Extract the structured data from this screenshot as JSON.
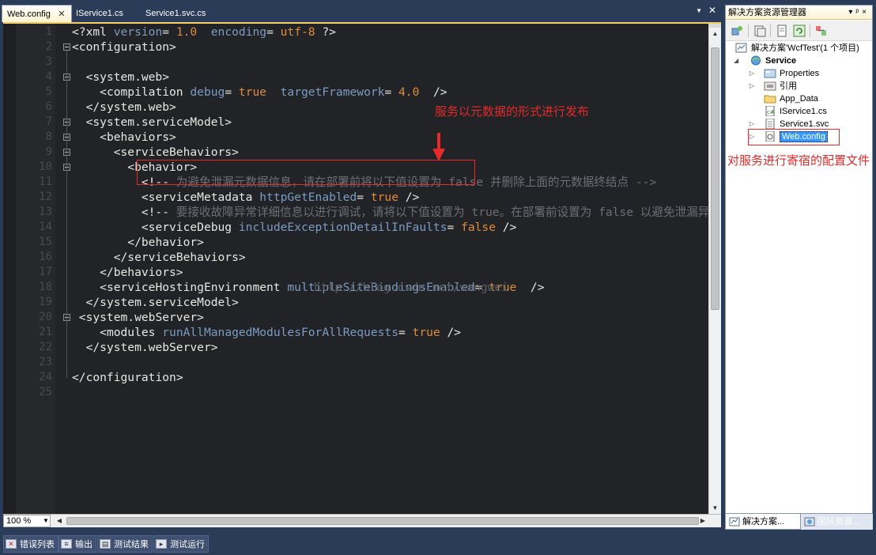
{
  "tabs": [
    {
      "label": "Web.config",
      "active": true
    },
    {
      "label": "IService1.cs",
      "active": false
    },
    {
      "label": "Service1.svc.cs",
      "active": false
    }
  ],
  "editor": {
    "line_numbers": [
      "1",
      "2",
      "3",
      "4",
      "5",
      "6",
      "7",
      "8",
      "9",
      "10",
      "11",
      "12",
      "13",
      "14",
      "15",
      "16",
      "17",
      "18",
      "19",
      "20",
      "21",
      "22",
      "23",
      "24",
      "25"
    ],
    "lines": [
      [
        [
          "punc",
          "<?"
        ],
        [
          "tag",
          "xml"
        ],
        [
          "punc",
          " "
        ],
        [
          "attr",
          "version"
        ],
        [
          "punc",
          "= "
        ],
        [
          "val",
          "1.0"
        ],
        [
          "punc",
          "  "
        ],
        [
          "attr",
          "encoding"
        ],
        [
          "punc",
          "= "
        ],
        [
          "val",
          "utf-8"
        ],
        [
          "punc",
          " ?>"
        ]
      ],
      [
        [
          "punc",
          "<"
        ],
        [
          "tag",
          "configuration"
        ],
        [
          "punc",
          ">"
        ]
      ],
      [],
      [
        [
          "punc",
          "  <"
        ],
        [
          "tag",
          "system.web"
        ],
        [
          "punc",
          ">"
        ]
      ],
      [
        [
          "punc",
          "    <"
        ],
        [
          "tag",
          "compilation"
        ],
        [
          "punc",
          " "
        ],
        [
          "attr",
          "debug"
        ],
        [
          "punc",
          "= "
        ],
        [
          "val",
          "true"
        ],
        [
          "punc",
          "  "
        ],
        [
          "attr",
          "targetFramework"
        ],
        [
          "punc",
          "= "
        ],
        [
          "val",
          "4.0"
        ],
        [
          "punc",
          "  />"
        ]
      ],
      [
        [
          "punc",
          "  </"
        ],
        [
          "tag",
          "system.web"
        ],
        [
          "punc",
          ">"
        ]
      ],
      [
        [
          "punc",
          "  <"
        ],
        [
          "tag",
          "system.serviceModel"
        ],
        [
          "punc",
          ">"
        ]
      ],
      [
        [
          "punc",
          "    <"
        ],
        [
          "tag",
          "behaviors"
        ],
        [
          "punc",
          ">"
        ]
      ],
      [
        [
          "punc",
          "      <"
        ],
        [
          "tag",
          "serviceBehaviors"
        ],
        [
          "punc",
          ">"
        ]
      ],
      [
        [
          "punc",
          "        <"
        ],
        [
          "tag",
          "behavior"
        ],
        [
          "punc",
          ">"
        ]
      ],
      [
        [
          "punc",
          "          <!--"
        ],
        [
          "comment",
          " 为避免泄漏元数据信息，请在部署前将以下值设置为 false 并删除上面的元数据终结点 -->"
        ]
      ],
      [
        [
          "punc",
          "          <"
        ],
        [
          "tag",
          "serviceMetadata"
        ],
        [
          "punc",
          " "
        ],
        [
          "attr",
          "httpGetEnabled"
        ],
        [
          "punc",
          "= "
        ],
        [
          "val",
          "true"
        ],
        [
          "punc",
          " />"
        ]
      ],
      [
        [
          "punc",
          "          <!--"
        ],
        [
          "comment",
          " 要接收故障异常详细信息以进行调试，请将以下值设置为 true。在部署前设置为 false 以避免泄漏异常信息 -->"
        ]
      ],
      [
        [
          "punc",
          "          <"
        ],
        [
          "tag",
          "serviceDebug"
        ],
        [
          "punc",
          " "
        ],
        [
          "attr",
          "includeExceptionDetailInFaults"
        ],
        [
          "punc",
          "= "
        ],
        [
          "val",
          "false"
        ],
        [
          "punc",
          " />"
        ]
      ],
      [
        [
          "punc",
          "        </"
        ],
        [
          "tag",
          "behavior"
        ],
        [
          "punc",
          ">"
        ]
      ],
      [
        [
          "punc",
          "      </"
        ],
        [
          "tag",
          "serviceBehaviors"
        ],
        [
          "punc",
          ">"
        ]
      ],
      [
        [
          "punc",
          "    </"
        ],
        [
          "tag",
          "behaviors"
        ],
        [
          "punc",
          ">"
        ]
      ],
      [
        [
          "punc",
          "    <"
        ],
        [
          "tag",
          "serviceHostingEnvironment"
        ],
        [
          "punc",
          " "
        ],
        [
          "attr",
          "multipleSiteBindingsEnabled"
        ],
        [
          "punc",
          "= "
        ],
        [
          "val",
          "true"
        ],
        [
          "punc",
          "  />"
        ]
      ],
      [
        [
          "punc",
          "  </"
        ],
        [
          "tag",
          "system.serviceModel"
        ],
        [
          "punc",
          ">"
        ]
      ],
      [
        [
          "punc",
          " <"
        ],
        [
          "tag",
          "system.webServer"
        ],
        [
          "punc",
          ">"
        ]
      ],
      [
        [
          "punc",
          "    <"
        ],
        [
          "tag",
          "modules"
        ],
        [
          "punc",
          " "
        ],
        [
          "attr",
          "runAllManagedModulesForAllRequests"
        ],
        [
          "punc",
          "= "
        ],
        [
          "val",
          "true"
        ],
        [
          "punc",
          " />"
        ]
      ],
      [
        [
          "punc",
          "  </"
        ],
        [
          "tag",
          "system.webServer"
        ],
        [
          "punc",
          ">"
        ]
      ],
      [],
      [
        [
          "punc",
          "</"
        ],
        [
          "tag",
          "configuration"
        ],
        [
          "punc",
          ">"
        ]
      ],
      []
    ],
    "watermark": "http://blog.csdn.net/wangwei",
    "annotation_metadata": "服务以元数据的形式进行发布",
    "zoom": "100 %"
  },
  "solution_explorer": {
    "title": "解决方案资源管理器",
    "title_buttons": "▾ ᵖ ×",
    "solution_label": "解决方案'WcfTest'(1 个项目)",
    "project_label": "Service",
    "items": [
      {
        "label": "Properties",
        "icon": "properties-icon",
        "expandable": true
      },
      {
        "label": "引用",
        "icon": "references-icon",
        "expandable": true
      },
      {
        "label": "App_Data",
        "icon": "folder-icon",
        "expandable": false
      },
      {
        "label": "IService1.cs",
        "icon": "csharp-file-icon",
        "expandable": false
      },
      {
        "label": "Service1.svc",
        "icon": "svc-file-icon",
        "expandable": true
      },
      {
        "label": "Web.config",
        "icon": "config-file-icon",
        "expandable": true,
        "selected": true
      }
    ],
    "annotation_config": "对服务进行寄宿的配置文件",
    "bottom_tabs": [
      {
        "label": "解决方案...",
        "active": true
      },
      {
        "label": "团队资源...",
        "active": false
      }
    ]
  },
  "dock_tabs": [
    {
      "label": "错误列表",
      "icon": "error-list-icon"
    },
    {
      "label": "输出",
      "icon": "output-icon"
    },
    {
      "label": "测试结果",
      "icon": "test-results-icon"
    },
    {
      "label": "测试运行",
      "icon": "test-run-icon"
    }
  ],
  "colors": {
    "editor_background": "#222327",
    "tag": "#e8e8e2",
    "attribute": "#7a9cc3",
    "value": "#e08c3a",
    "comment": "#6b7076",
    "annotation": "#e42a2a",
    "chrome": "#2b3c59"
  }
}
